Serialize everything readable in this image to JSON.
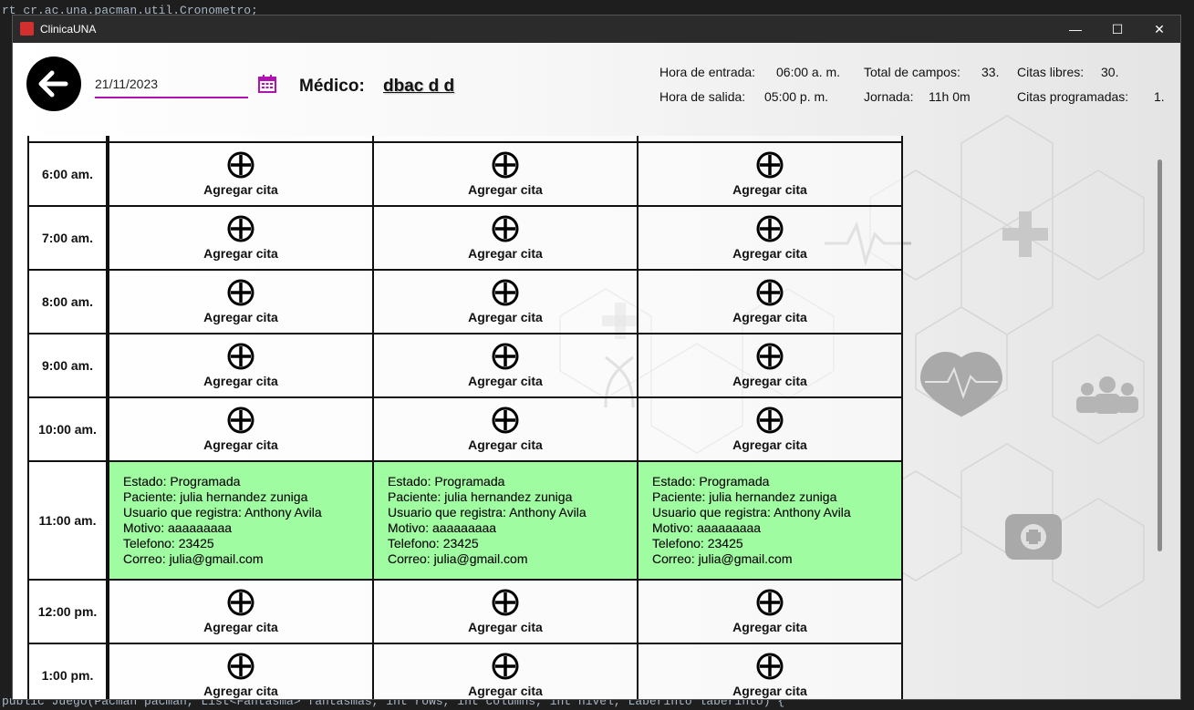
{
  "background_code": {
    "top_line": "rt cr.ac.una.pacman.util.Cronometro;",
    "bottom_line": "public Juego(Pacman pacman, List<Fantasma> fantasmas, int rows, int columns, int nivel, Laberinto laberinto) {"
  },
  "window": {
    "title": "ClinicaUNA",
    "minimize_label": "—",
    "maximize_label": "☐",
    "close_label": "✕"
  },
  "header": {
    "date_value": "21/11/2023",
    "medico_label": "Médico:",
    "medico_name": "dbac d d",
    "hora_entrada_label": "Hora de entrada:",
    "hora_entrada_value": "06:00 a. m.",
    "hora_salida_label": "Hora de salida:",
    "hora_salida_value": "05:00 p. m.",
    "total_campos_label": "Total de campos:",
    "total_campos_value": "33.",
    "jornada_label": "Jornada:",
    "jornada_value": "11h 0m",
    "citas_libres_label": "Citas libres:",
    "citas_libres_value": "30.",
    "citas_programadas_label": "Citas programadas:",
    "citas_programadas_value": "1."
  },
  "schedule": {
    "add_label": "Agregar cita",
    "rows": [
      {
        "hour": "6:00 am."
      },
      {
        "hour": "7:00 am."
      },
      {
        "hour": "8:00 am."
      },
      {
        "hour": "9:00 am."
      },
      {
        "hour": "10:00 am."
      },
      {
        "hour": "11:00 am."
      },
      {
        "hour": "12:00 pm."
      },
      {
        "hour": "1:00 pm."
      }
    ],
    "booked": {
      "estado": "Estado: Programada",
      "paciente": "Paciente: julia hernandez zuniga",
      "usuario": "Usuario que registra: Anthony Avila",
      "motivo": "Motivo: aaaaaaaaa",
      "telefono": "Telefono: 23425",
      "correo": "Correo: julia@gmail.com"
    }
  },
  "colors": {
    "booked_bg": "#a0fca0",
    "date_underline": "#b012b0",
    "titlebar_bg": "#2b2b2b"
  },
  "icons": [
    "back-arrow-icon",
    "calendar-icon",
    "add-circle-icon",
    "minimize-icon",
    "maximize-icon",
    "close-icon"
  ]
}
